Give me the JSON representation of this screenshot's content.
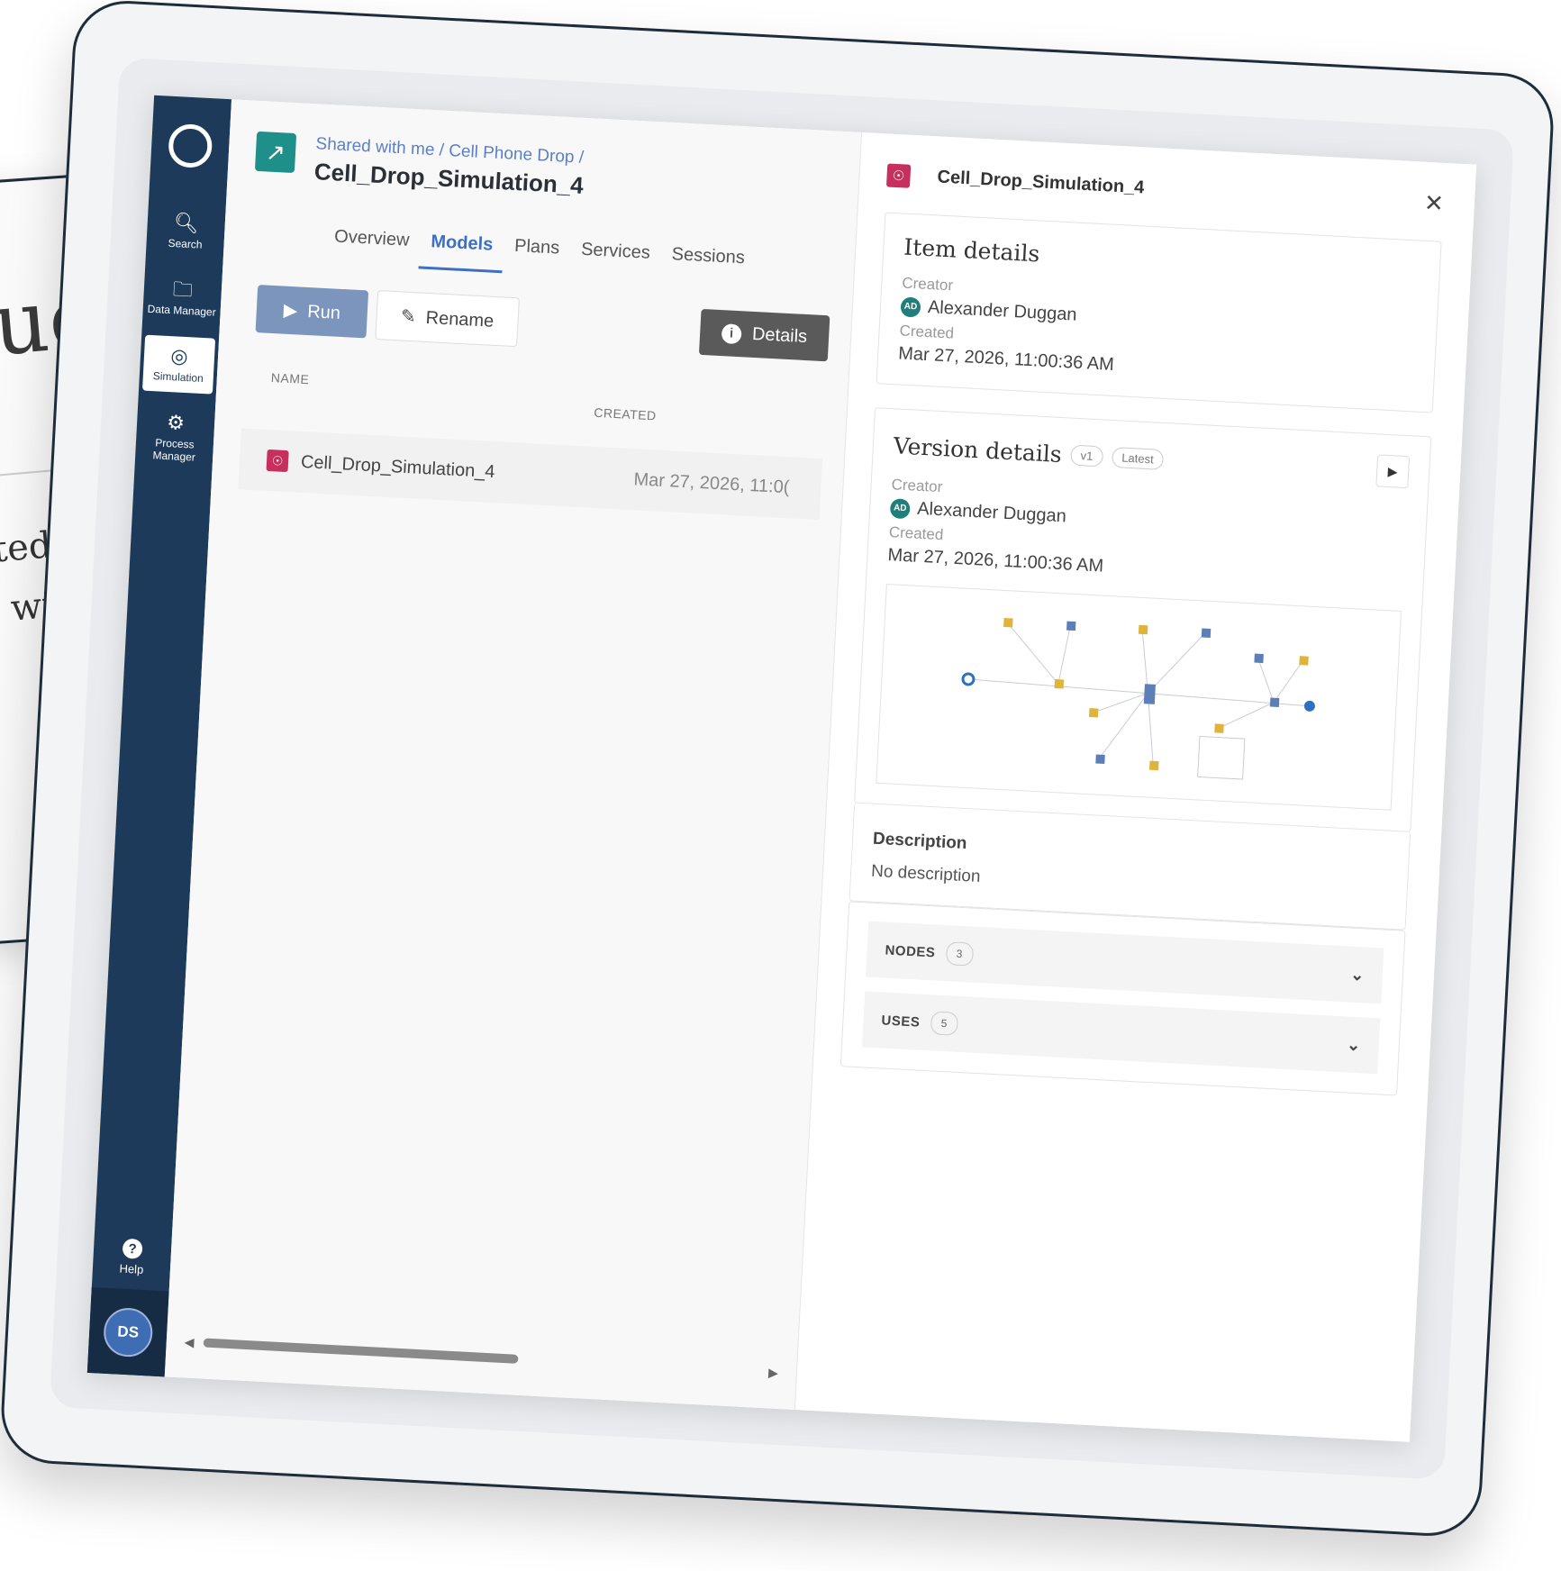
{
  "background": {
    "letters": "uc",
    "line1": "ted",
    "line2": "wit"
  },
  "nav": {
    "items": [
      {
        "label": "Search",
        "icon": "search-icon"
      },
      {
        "label": "Data Manager",
        "icon": "folder-icon"
      },
      {
        "label": "Simulation",
        "icon": "simulation-icon"
      },
      {
        "label": "Process Manager",
        "icon": "gear-icon"
      }
    ],
    "help_label": "Help",
    "user_initials": "DS"
  },
  "header": {
    "breadcrumb_1": "Shared with me",
    "breadcrumb_2": "Cell Phone Drop",
    "sep": "/",
    "title": "Cell_Drop_Simulation_4"
  },
  "tabs": [
    "Overview",
    "Models",
    "Plans",
    "Services",
    "Sessions"
  ],
  "active_tab": "Models",
  "toolbar": {
    "run_label": "Run",
    "rename_label": "Rename",
    "details_label": "Details"
  },
  "table": {
    "col_name": "NAME",
    "col_created": "CREATED",
    "rows": [
      {
        "name": "Cell_Drop_Simulation_4",
        "created": "Mar 27, 2026, 11:0("
      }
    ]
  },
  "panel": {
    "title": "Cell_Drop_Simulation_4",
    "item_details": {
      "heading": "Item details",
      "creator_label": "Creator",
      "creator_initials": "AD",
      "creator_name": "Alexander Duggan",
      "created_label": "Created",
      "created_value": "Mar 27, 2026, 11:00:36 AM"
    },
    "version_details": {
      "heading": "Version details",
      "version_badge": "v1",
      "latest_badge": "Latest",
      "creator_label": "Creator",
      "creator_initials": "AD",
      "creator_name": "Alexander Duggan",
      "created_label": "Created",
      "created_value": "Mar 27, 2026, 11:00:36 AM"
    },
    "description": {
      "heading": "Description",
      "value": "No description"
    },
    "nodes": {
      "label": "NODES",
      "count": "3"
    },
    "uses": {
      "label": "USES",
      "count": "5"
    }
  },
  "colors": {
    "nav_bg": "#1e3a5a",
    "accent": "#3e6fc2",
    "model_icon": "#c62f5e",
    "header_icon": "#1f8f8a"
  }
}
